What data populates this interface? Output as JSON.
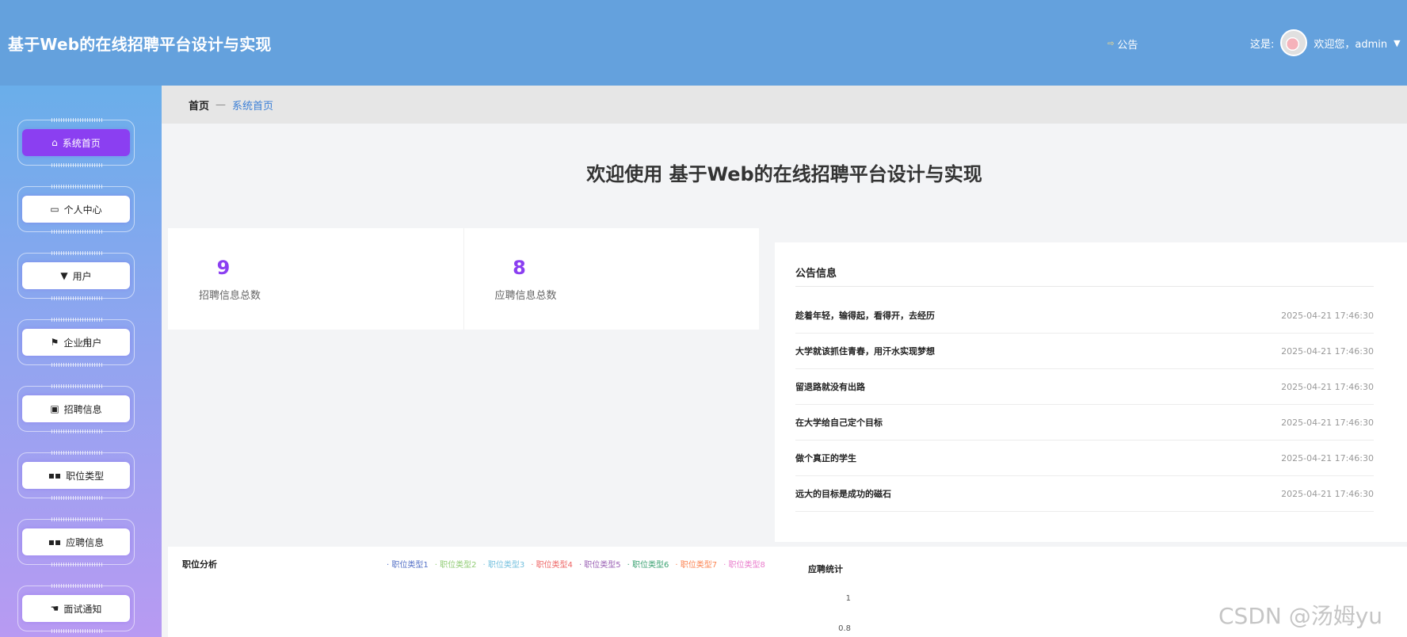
{
  "header": {
    "title": "基于Web的在线招聘平台设计与实现",
    "notice_label": "公告",
    "user_prefix": "这是:",
    "welcome_user": "欢迎您，admin"
  },
  "sidebar": {
    "items": [
      {
        "label": "系统首页",
        "icon": "home-icon",
        "active": true
      },
      {
        "label": "个人中心",
        "icon": "card-icon",
        "active": false
      },
      {
        "label": "用户",
        "icon": "user-icon",
        "active": false
      },
      {
        "label": "企业用户",
        "icon": "flag-icon",
        "active": false
      },
      {
        "label": "招聘信息",
        "icon": "clipboard-icon",
        "active": false
      },
      {
        "label": "职位类型",
        "icon": "grid-icon",
        "active": false
      },
      {
        "label": "应聘信息",
        "icon": "grid-icon",
        "active": false
      },
      {
        "label": "面试通知",
        "icon": "like-icon",
        "active": false
      }
    ]
  },
  "breadcrumb": {
    "home": "首页",
    "separator": "—",
    "current": "系统首页"
  },
  "main": {
    "welcome": "欢迎使用 基于Web的在线招聘平台设计与实现",
    "stats": [
      {
        "value": "9",
        "label": "招聘信息总数"
      },
      {
        "value": "8",
        "label": "应聘信息总数"
      }
    ]
  },
  "notices": {
    "title": "公告信息",
    "items": [
      {
        "title": "趁着年轻，输得起，看得开，去经历",
        "date": "2025-04-21 17:46:30"
      },
      {
        "title": "大学就该抓住青春，用汗水实现梦想",
        "date": "2025-04-21 17:46:30"
      },
      {
        "title": "留退路就没有出路",
        "date": "2025-04-21 17:46:30"
      },
      {
        "title": "在大学给自己定个目标",
        "date": "2025-04-21 17:46:30"
      },
      {
        "title": "做个真正的学生",
        "date": "2025-04-21 17:46:30"
      },
      {
        "title": "远大的目标是成功的磁石",
        "date": "2025-04-21 17:46:30"
      }
    ]
  },
  "job_chart": {
    "title": "职位分析",
    "legend": [
      "职位类型1",
      "职位类型2",
      "职位类型3",
      "职位类型4",
      "职位类型5",
      "职位类型6",
      "职位类型7",
      "职位类型8"
    ],
    "colors": [
      "#5470c6",
      "#91cc75",
      "#73c0de",
      "#ee6666",
      "#9a60b4",
      "#3ba272",
      "#fc8452",
      "#ea7ccc"
    ]
  },
  "apply_chart": {
    "title": "应聘统计",
    "y_ticks": [
      "1",
      "0.8"
    ]
  },
  "watermark": "CSDN @汤姆yu",
  "colors": {
    "header": "#64a1dd",
    "accent": "#8b3ff1"
  }
}
